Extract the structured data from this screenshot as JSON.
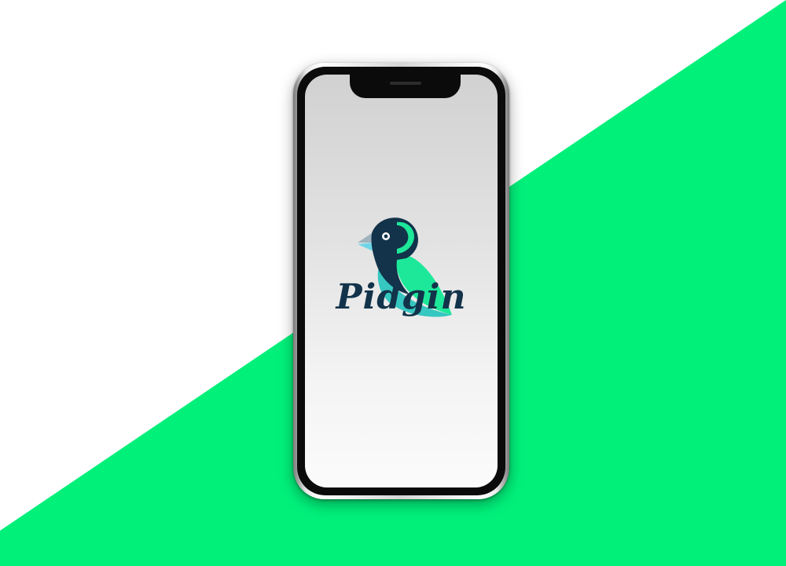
{
  "app": {
    "name": "Pidgin"
  },
  "colors": {
    "background_accent": "#00f07a",
    "background_light": "#ffffff",
    "brand_dark": "#12334a",
    "brand_green": "#1de89a",
    "brand_teal": "#35c7c0",
    "beak_blue": "#6fd6e6",
    "screen_top": "#d1d1d1",
    "screen_bottom": "#fbfbfb"
  },
  "icons": {
    "logo": "bird-icon"
  }
}
